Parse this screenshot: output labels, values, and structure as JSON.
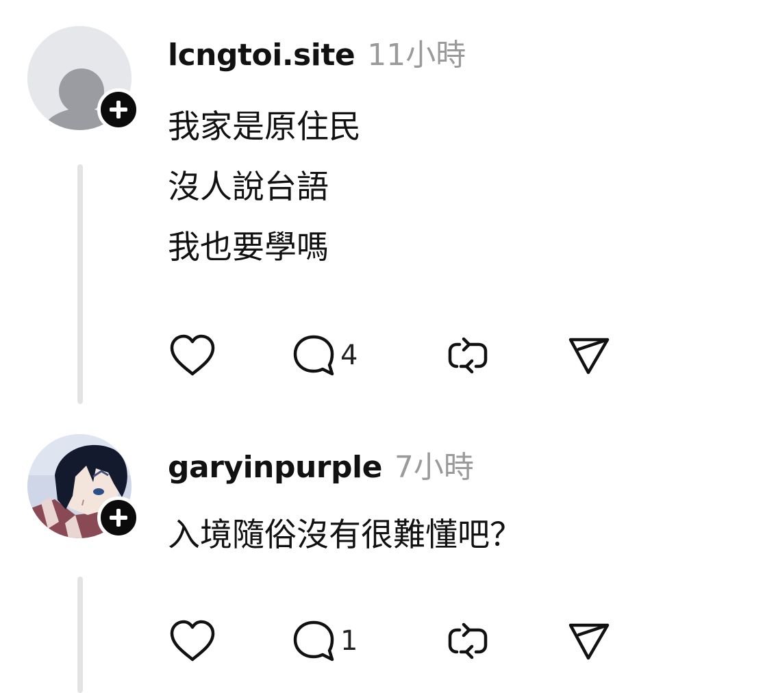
{
  "posts": [
    {
      "username": "lcngtoi.site",
      "time": "11小時",
      "lines": [
        "我家是原住民",
        "沒人說台語",
        "我也要學嗎"
      ],
      "actions": {
        "reply_count": "4"
      }
    },
    {
      "username": "garyinpurple",
      "time": "7小時",
      "lines": [
        "入境隨俗沒有很難懂吧？"
      ],
      "actions": {
        "reply_count": "1"
      }
    }
  ],
  "icons": {
    "like": "heart-icon",
    "reply": "comment-bubble-icon",
    "repost": "repost-icon",
    "share": "send-icon",
    "follow": "plus-icon"
  },
  "colors": {
    "username": "#111111",
    "timestamp": "#9a9a9a",
    "thread_line": "#e3e3e3",
    "badge": "#0b0b0b",
    "icon": "#111111"
  }
}
